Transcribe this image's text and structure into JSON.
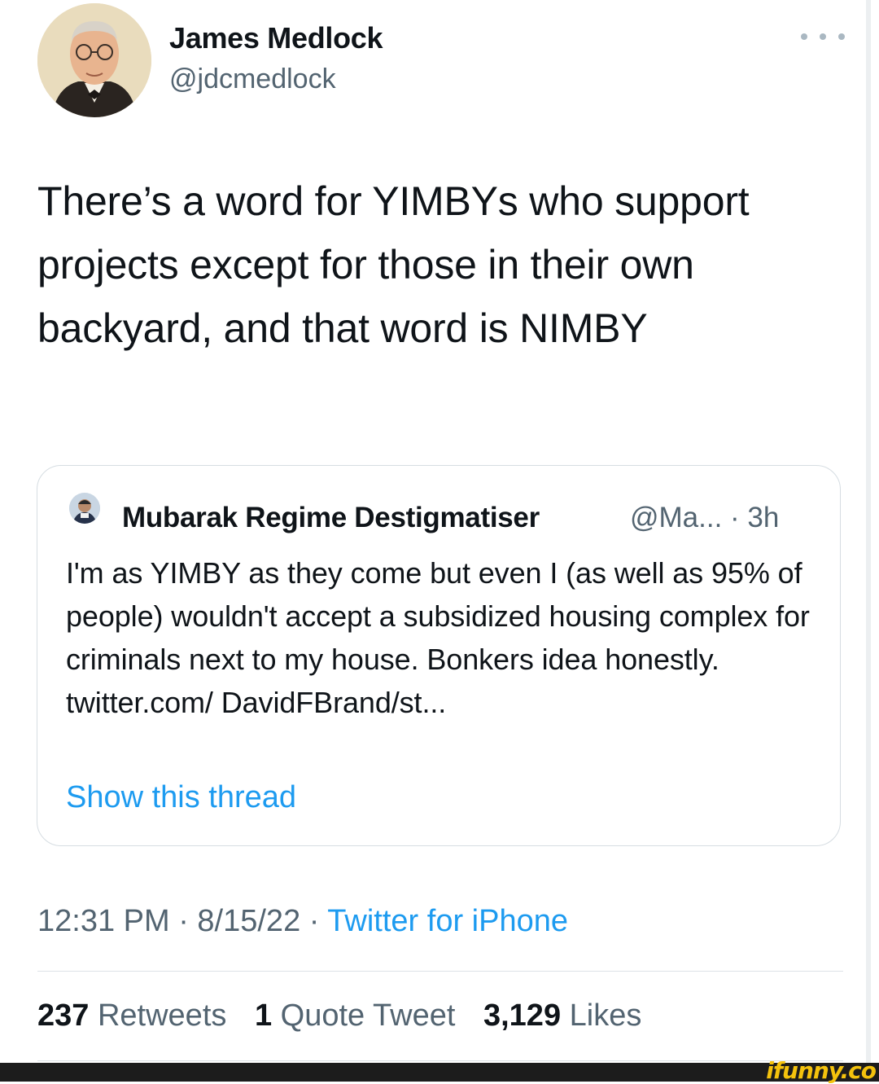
{
  "author": {
    "name": "James Medlock",
    "handle": "@jdcmedlock"
  },
  "tweet": {
    "text": "There’s a word for YIMBYs who support projects except for those in their own backyard, and that word is NIMBY"
  },
  "quoted": {
    "name": "Mubarak Regime Destigmatiser",
    "handle_time": "@Ma... · 3h",
    "text": "I'm as YIMBY as they come but even I (as well as 95% of people) wouldn't accept a subsidized housing complex for criminals next to my house. Bonkers idea honestly. twitter.com/ DavidFBrand/st...",
    "show_thread": "Show this thread"
  },
  "meta": {
    "time_date": "12:31 PM · 8/15/22 · ",
    "source": "Twitter for iPhone"
  },
  "stats": {
    "retweets_count": "237",
    "retweets_label": "Retweets",
    "quotes_count": "1",
    "quotes_label": "Quote Tweet",
    "likes_count": "3,129",
    "likes_label": "Likes"
  },
  "watermark": "ifunny.co",
  "colors": {
    "link": "#1d9bf0",
    "secondary_text": "#536471",
    "watermark": "#f4c20d"
  }
}
